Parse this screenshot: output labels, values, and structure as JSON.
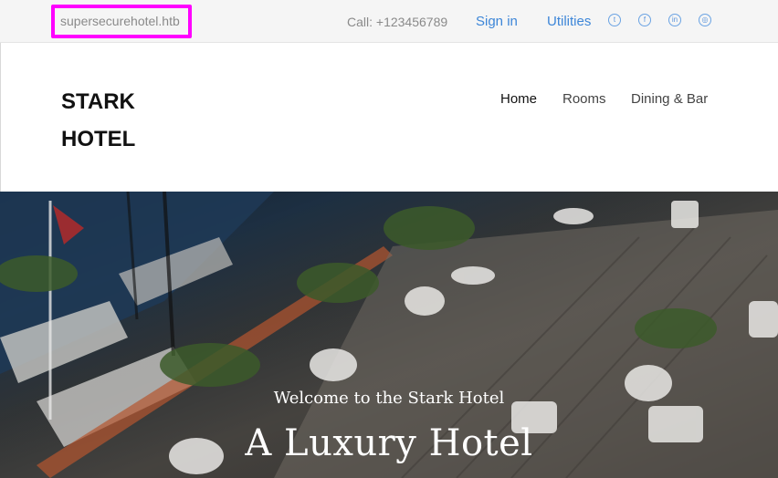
{
  "topbar": {
    "domain": "supersecurehotel.htb",
    "call": "Call: +123456789",
    "sign_in": "Sign in",
    "utilities": "Utilities",
    "social_icons": [
      "twitter-icon",
      "facebook-icon",
      "linkedin-icon",
      "dribbble-icon"
    ],
    "link_color": "#3d86d8",
    "highlight_color": "#ff00ff"
  },
  "header": {
    "logo_line1": "STARK",
    "logo_line2": "HOTEL",
    "nav": [
      "Home",
      "Rooms",
      "Dining & Bar"
    ]
  },
  "hero": {
    "welcome": "Welcome to the Stark Hotel",
    "headline": "A Luxury Hotel"
  }
}
